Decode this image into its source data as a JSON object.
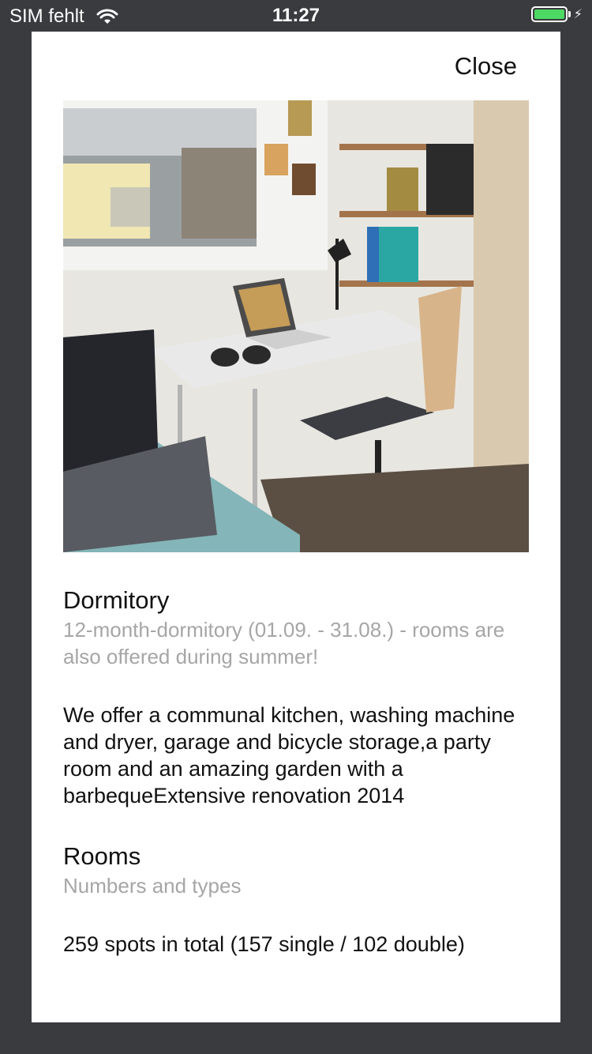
{
  "status_bar": {
    "carrier": "SIM fehlt",
    "time": "11:27",
    "battery_level": 1.0
  },
  "modal": {
    "close_label": "Close",
    "photo_alt": "dorm room photo"
  },
  "sections": [
    {
      "title": "Dormitory",
      "subtitle": "12-month-dormitory (01.09. - 31.08.) - rooms are also offered during summer!",
      "body": "We offer a communal kitchen, washing machine and dryer, garage and bicycle storage,a party room and an amazing garden with a barbequeExtensive renovation 2014"
    },
    {
      "title": "Rooms",
      "subtitle": "Numbers and types",
      "body": "259 spots in total (157 single / 102 double)"
    }
  ],
  "colors": {
    "background": "#3a3b3e",
    "card": "#ffffff",
    "subtitle": "#a6a6a6",
    "battery": "#4cd964"
  },
  "icons": [
    "wifi-icon",
    "battery-icon",
    "charging-bolt-icon"
  ]
}
